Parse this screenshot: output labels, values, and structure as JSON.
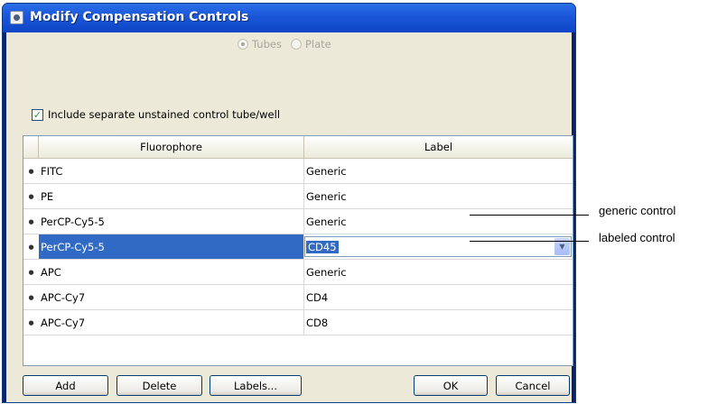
{
  "window": {
    "title": "Modify Compensation Controls"
  },
  "mode": {
    "options": [
      {
        "label": "Tubes",
        "selected": true
      },
      {
        "label": "Plate",
        "selected": false
      }
    ]
  },
  "unstained": {
    "label": "Include separate unstained control tube/well",
    "checked": true
  },
  "table": {
    "columns": [
      "Fluorophore",
      "Label"
    ],
    "rows": [
      {
        "fluorophore": "FITC",
        "label": "Generic"
      },
      {
        "fluorophore": "PE",
        "label": "Generic"
      },
      {
        "fluorophore": "PerCP-Cy5-5",
        "label": "Generic"
      },
      {
        "fluorophore": "PerCP-Cy5-5",
        "label": "CD45",
        "selected": true,
        "editing": true
      },
      {
        "fluorophore": "APC",
        "label": "Generic"
      },
      {
        "fluorophore": "APC-Cy7",
        "label": "CD4"
      },
      {
        "fluorophore": "APC-Cy7",
        "label": "CD8"
      }
    ]
  },
  "buttons": {
    "add": "Add",
    "delete": "Delete",
    "labels": "Labels...",
    "ok": "OK",
    "cancel": "Cancel"
  },
  "annotations": {
    "generic": "generic control",
    "labeled": "labeled control"
  }
}
